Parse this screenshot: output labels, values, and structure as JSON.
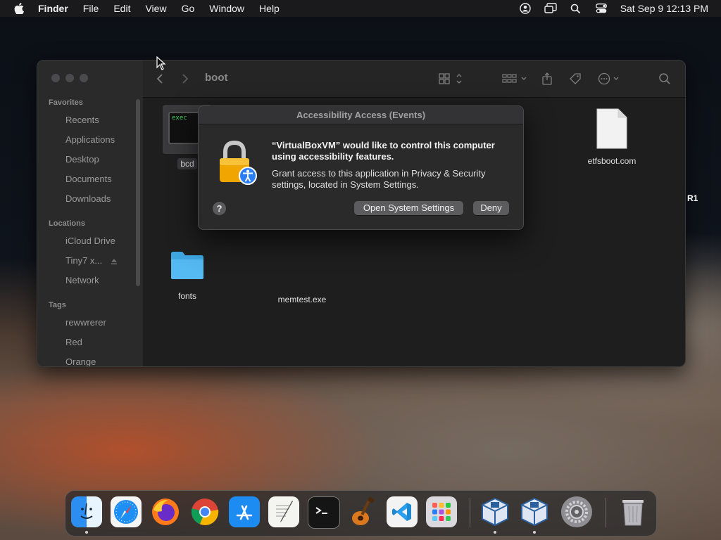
{
  "menubar": {
    "app_name": "Finder",
    "menus": [
      "File",
      "Edit",
      "View",
      "Go",
      "Window",
      "Help"
    ],
    "clock": "Sat Sep 9  12:13 PM"
  },
  "finder": {
    "path_title": "boot",
    "sidebar": {
      "favorites_header": "Favorites",
      "favorites": [
        "Recents",
        "Applications",
        "Desktop",
        "Documents",
        "Downloads"
      ],
      "locations_header": "Locations",
      "locations": [
        "iCloud Drive",
        "Tiny7 x...",
        "Network"
      ],
      "tags_header": "Tags",
      "tags": [
        {
          "label": "rewwrerer",
          "color": "#3a3a3a"
        },
        {
          "label": "Red",
          "color": "#3a3a3a"
        },
        {
          "label": "Orange",
          "color": "#3a3a3a"
        }
      ]
    },
    "files": [
      {
        "name": "bcd",
        "kind": "exec",
        "icon_text": "exec"
      },
      {
        "name": "etfsboot.com",
        "kind": "document"
      },
      {
        "name": "fonts",
        "kind": "folder"
      },
      {
        "name": "memtest.exe",
        "kind": "document"
      }
    ],
    "side_label": "R1"
  },
  "dialog": {
    "title": "Accessibility Access (Events)",
    "heading": "“VirtualBoxVM” would like to control this computer using accessibility features.",
    "body": "Grant access to this application in Privacy & Security settings, located in System Settings.",
    "help_label": "?",
    "primary_button": "Open System Settings",
    "secondary_button": "Deny"
  },
  "dock": {
    "apps": [
      "Finder",
      "Safari",
      "Firefox",
      "Chrome",
      "App Store",
      "TextEdit",
      "Terminal",
      "GarageBand",
      "Visual Studio Code",
      "Launchpad",
      "VirtualBox",
      "VirtualBox",
      "System Settings",
      "Trash"
    ]
  },
  "colors": {
    "accent": "#2a7ff8",
    "folder": "#4fb6f0"
  }
}
